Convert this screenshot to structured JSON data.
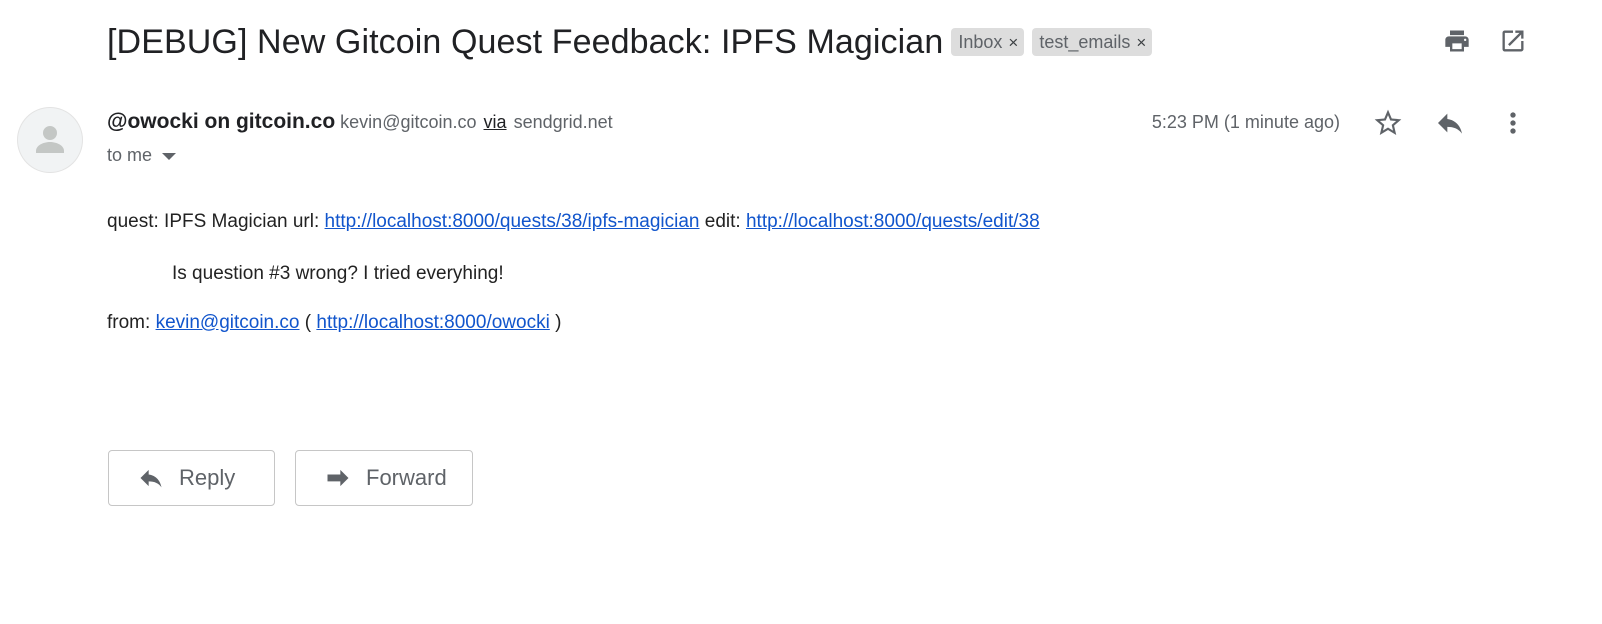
{
  "subject": "[DEBUG] New Gitcoin Quest Feedback: IPFS Magician",
  "labels": [
    {
      "name": "Inbox",
      "remove": "×"
    },
    {
      "name": "test_emails",
      "remove": "×"
    }
  ],
  "toolbar_icons": [
    "print-icon",
    "open-in-new-window-icon"
  ],
  "sender": {
    "name": "@owocki on gitcoin.co",
    "email": "kevin@gitcoin.co",
    "via": "via",
    "relay": "sendgrid.net",
    "to": "to me"
  },
  "timestamp": "5:23 PM (1 minute ago)",
  "header_icons": [
    "star-icon",
    "reply-icon",
    "more-vert-icon"
  ],
  "body": {
    "quest_prefix": "quest: IPFS Magician url:",
    "quest_url": "http://localhost:8000/quests/38/ipfs-magician",
    "edit_prefix": "edit:",
    "edit_url": "http://localhost:8000/quests/edit/38",
    "quote": "Is question #3 wrong? I tried everyhing!",
    "from_prefix": "from:",
    "from_email": "kevin@gitcoin.co",
    "paren_open": "(",
    "profile_url": "http://localhost:8000/owocki",
    "paren_close": ")"
  },
  "actions": {
    "reply": "Reply",
    "forward": "Forward"
  },
  "colors": {
    "link": "#1155cc",
    "chip_bg": "#dddddd",
    "muted_text": "#5f6368",
    "icon": "#5f6368"
  }
}
